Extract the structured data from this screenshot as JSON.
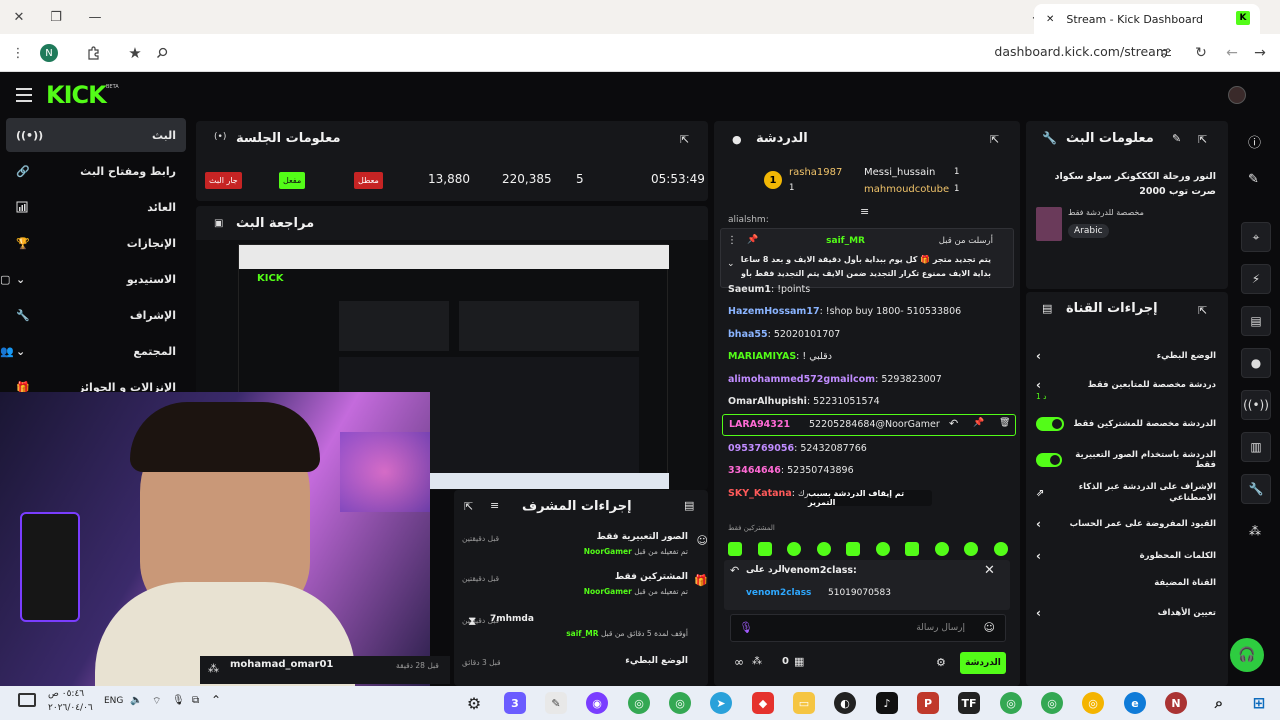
{
  "browser": {
    "tab_title": "Stream - Kick Dashboard",
    "url": "dashboard.kick.com/stream",
    "profile_initial": "N",
    "controls": {
      "close": "✕",
      "restore": "❐",
      "minimize": "—",
      "new_tab": "+",
      "tab_close": "✕"
    }
  },
  "app": {
    "logo": "KICK",
    "logo_sup": "BETA",
    "sidebar": [
      {
        "label": "البث",
        "icon": "broadcast-icon",
        "active": true
      },
      {
        "label": "رابط ومفتاح البث",
        "icon": "link-icon"
      },
      {
        "label": "العائد",
        "icon": "chart-icon"
      },
      {
        "label": "الإنجازات",
        "icon": "trophy-icon"
      },
      {
        "label": "الاستيديو",
        "icon": "studio-icon"
      },
      {
        "label": "الإشراف",
        "icon": "wrench-icon"
      },
      {
        "label": "المجتمع",
        "icon": "community-icon"
      },
      {
        "label": "الإنزالات و الجوائز",
        "icon": "gift-icon"
      }
    ],
    "session": {
      "title": "معلومات الجلسة",
      "stats": [
        "05:53:49",
        "5",
        "220,385",
        "13,880"
      ],
      "badges": [
        "معطل",
        "مفعل",
        "جار البث"
      ]
    },
    "preview": {
      "title": "مراجعة البث"
    },
    "mod_actions": {
      "title": "إجراءات المشرف",
      "rows": [
        {
          "title": "الصور التعبيرية فقط",
          "sub_pre": "تم تفعيله من قبل",
          "sub_user": "NoorGamer",
          "time": "قبل دقيقتين"
        },
        {
          "title": "المشتركين فقط",
          "sub_pre": "تم تفعيله من قبل",
          "sub_user": "NoorGamer",
          "time": "قبل دقيقتين"
        },
        {
          "title": "7mhmda",
          "sub_pre": "أوقف لمدة 5 دقائق من قبل",
          "sub_user": "saif_MR",
          "time": "قبل دقيقتين"
        },
        {
          "title": "الوضع البطيء",
          "sub_pre": "",
          "sub_user": "",
          "time": "قبل 3 دقائق"
        }
      ]
    },
    "feed_user": {
      "name": "mohamad_omar01",
      "time": "قبل 28 دقيقة"
    },
    "chat": {
      "title": "الدردشة",
      "leaders": [
        {
          "name": "rasha1987",
          "count": "1"
        },
        {
          "name": "Messi_hussain",
          "count": "1"
        },
        {
          "name": "mahmoudcotube",
          "count": "1"
        }
      ],
      "top_cut": "alialshm:",
      "pinned": {
        "user": "saif_MR",
        "label": "أرسلت من قبل",
        "text1": "يتم تجديد متجر 🎁 كل يوم ببداية بأول دقيقة الايف و بعد 8 ساعات من",
        "text2": "بداية الايف ممنوع تكرار التجديد ضمن الايف يتم التجديد فقط بأول دقيقة"
      },
      "messages": [
        {
          "user": "Saeum1",
          "text": "!points",
          "color": "#e6e6e6"
        },
        {
          "user": "HazemHossam17",
          "text": "!shop buy 1800- 510533806",
          "color": "#8ab4ff"
        },
        {
          "user": "bhaa55",
          "text": "52020101707",
          "color": "#8ab4ff"
        },
        {
          "user": "MARIAMIYAS",
          "text": "! دقلبي",
          "color": "#53fc18"
        },
        {
          "user": "alimohammed572gmailcom",
          "text": "5293823007",
          "color": "#c08cff"
        },
        {
          "user": "OmarAlhupishi",
          "text": "52231051574",
          "color": "#e6e6e6"
        },
        {
          "user": "LARA94321",
          "text": "52205284684@NoorGamer",
          "color": "#ff6ad5"
        },
        {
          "user": "0953769056",
          "text": "52432087766",
          "color": "#c08cff"
        },
        {
          "user": "33464646",
          "text": "52350743896",
          "color": "#ff6ad5"
        },
        {
          "user": "SKY_Katana",
          "text": "شيرك يجيب عرك",
          "color": "#ff5a5a"
        }
      ],
      "paused_notice": "تم إيقاف الدردشة بسبب التمرير",
      "subs_only": "المشتركين فقط",
      "reply_to_label": "الرد على",
      "reply_user": "venom2class:",
      "reply_quote_user": "venom2class",
      "reply_quote_text": "51019070583",
      "input_placeholder": "إرسال رسالة",
      "send_label": "الدردشة",
      "viewer_count": "0"
    },
    "stream_info": {
      "title": "معلومات البث",
      "stream_title": "النور ورحلة الكككونكر سولو سكواد صرت توب 2000",
      "category": "مخصصة للدردشة فقط",
      "language": "Arabic"
    },
    "channel_actions": {
      "title": "إجراءات القناة",
      "items": [
        {
          "label": "الوضع البطيء",
          "type": "chevron"
        },
        {
          "label": "دردشة مخصصة للمتابعين فقط",
          "sub": "1 د",
          "type": "chevron"
        },
        {
          "label": "الدردشة مخصصة للمشتركين فقط",
          "type": "toggle"
        },
        {
          "label": "الدردشة باستخدام الصور التعبيرية فقط",
          "type": "toggle"
        },
        {
          "label": "الإشراف على الدردشة عبر الذكاء الاصطناعي",
          "type": "external"
        },
        {
          "label": "القيود المفروضة على عمر الحساب",
          "type": "chevron"
        },
        {
          "label": "الكلمات المحظورة",
          "type": "chevron"
        },
        {
          "label": "القناة المضيفة",
          "type": "none"
        },
        {
          "label": "تعيين الأهداف",
          "type": "chevron"
        }
      ]
    }
  },
  "taskbar": {
    "time": "٠٥:٤٦ ص",
    "date": "٢٠٢٦/٠٤/٠٦",
    "lang": "ENG"
  },
  "colors": {
    "accent": "#53fc18",
    "panel": "#16171a",
    "bg": "#0b0b0d"
  }
}
